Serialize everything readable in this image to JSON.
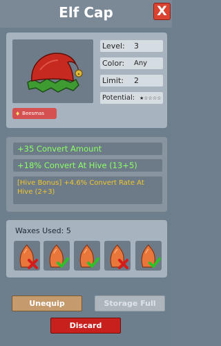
{
  "window": {
    "title": "Elf Cap",
    "close_label": "X"
  },
  "item": {
    "icon": "elf-cap-hat",
    "badge": "Beesmas",
    "badge_icon": "gift-icon"
  },
  "stats": {
    "level_label": "Level:",
    "level_value": "3",
    "color_label": "Color:",
    "color_value": "Any",
    "limit_label": "Limit:",
    "limit_value": "2",
    "potential_label": "Potential:",
    "potential_value": "★☆☆☆☆",
    "potential_stars": 1,
    "potential_max": 5
  },
  "bonuses": {
    "line1": "+35 Convert Amount",
    "line2": "+18% Convert At Hive (13+5)",
    "hive_line1": "[Hive Bonus] +4.6% Convert Rate At",
    "hive_line2": "Hive (2+3)",
    "colors": {
      "stat_text": "#8cff66",
      "hive_bonus_text": "#f0c62d"
    }
  },
  "waxes": {
    "title": "Waxes Used: 5",
    "slots": [
      {
        "result": "fail",
        "icon": "wax-fail-icon"
      },
      {
        "result": "success",
        "icon": "wax-success-icon"
      },
      {
        "result": "success",
        "icon": "wax-success-icon"
      },
      {
        "result": "fail",
        "icon": "wax-fail-icon"
      },
      {
        "result": "success",
        "icon": "wax-success-icon"
      }
    ]
  },
  "actions": {
    "unequip": "Unequip",
    "storage_full": "Storage Full",
    "discard": "Discard"
  }
}
